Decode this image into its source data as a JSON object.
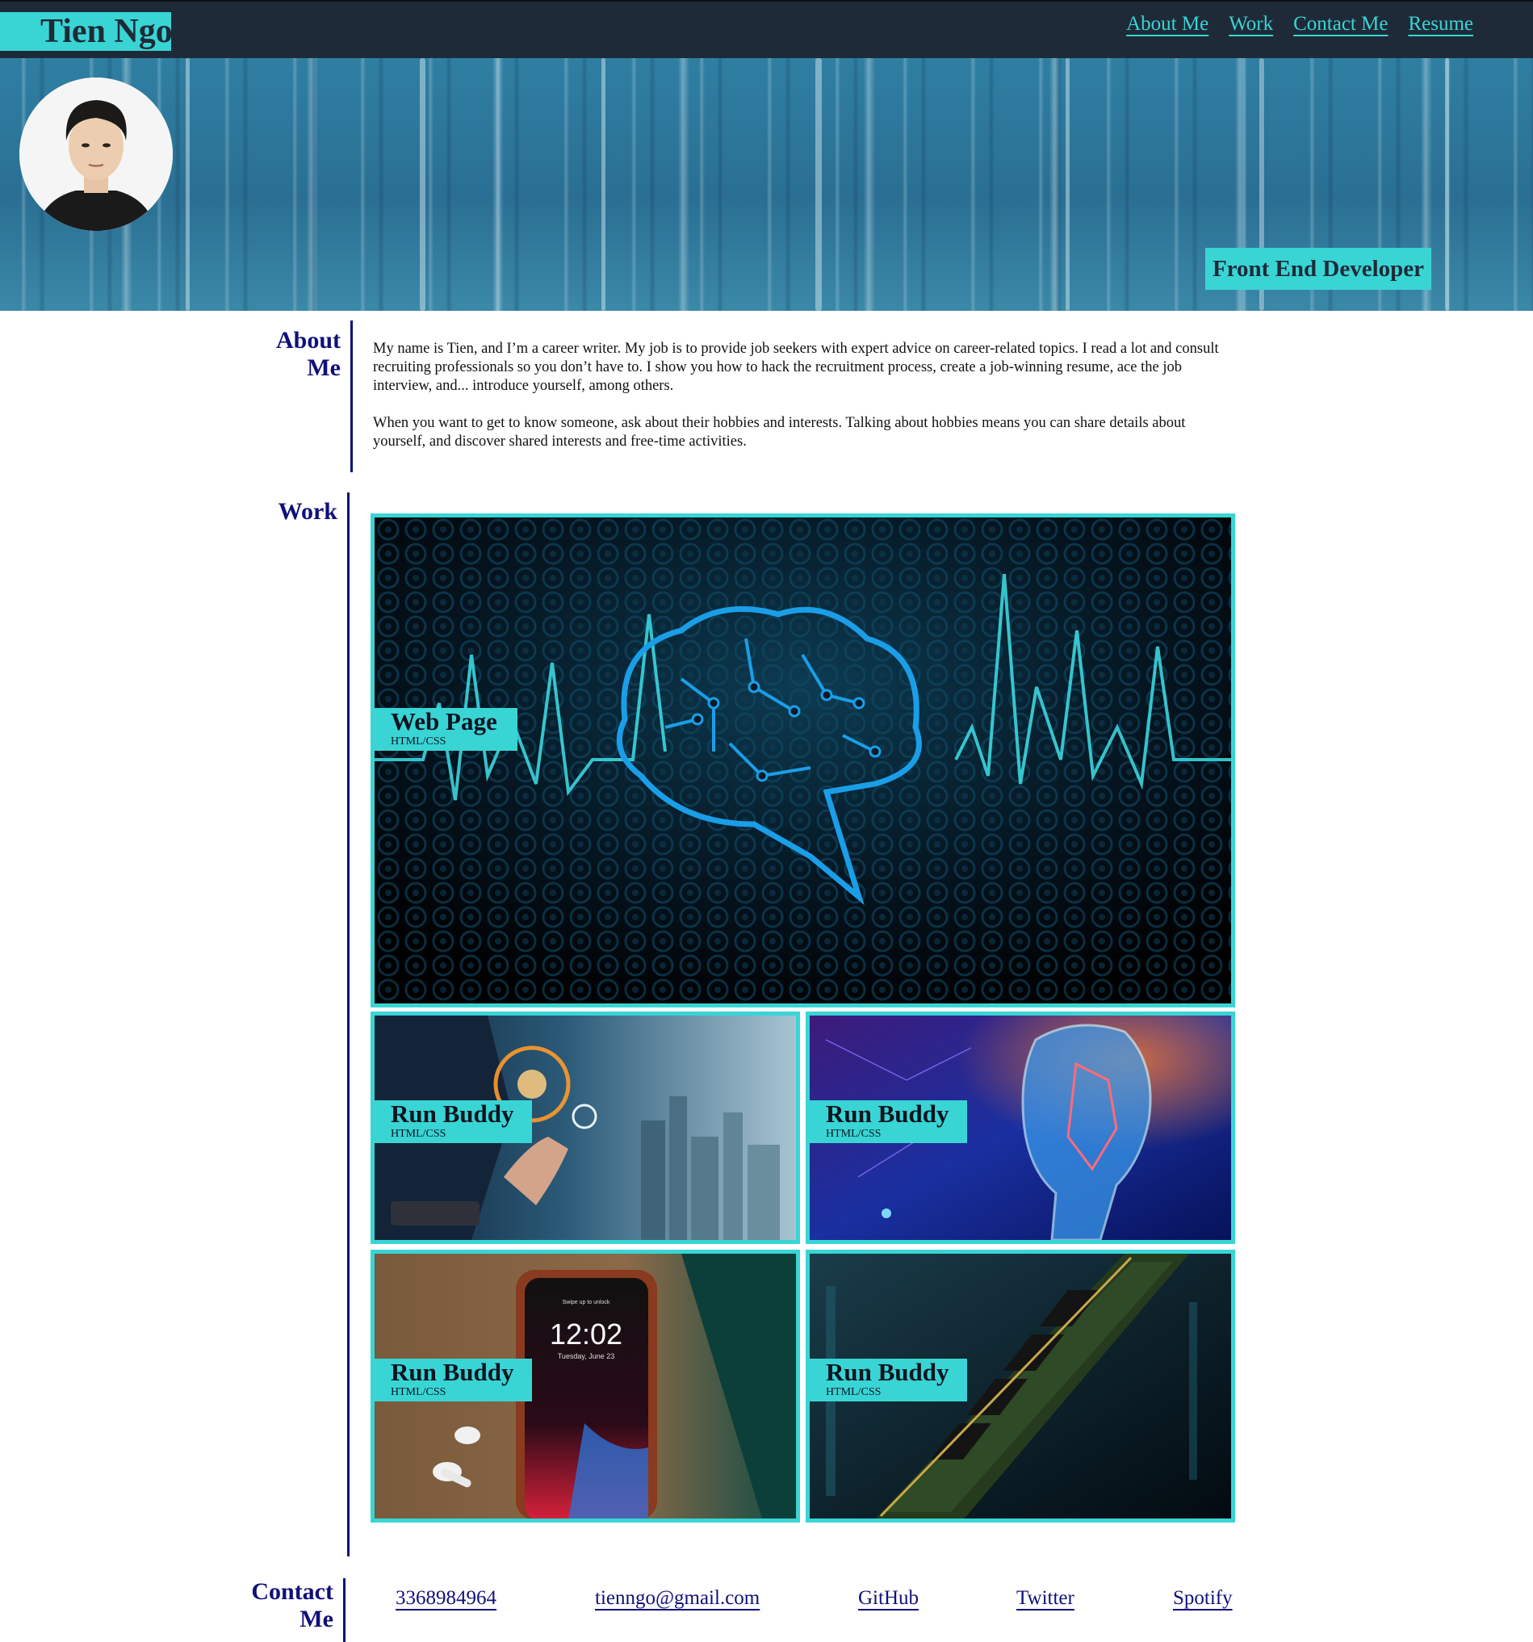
{
  "header": {
    "brand": "Tien Ngo",
    "nav": [
      "About Me",
      "Work",
      "Contact Me",
      "Resume"
    ]
  },
  "hero": {
    "role": "Front End Developer"
  },
  "about": {
    "title_line1": "About",
    "title_line2": "Me",
    "paragraphs": [
      "My name is Tien, and I’m a career writer. My job is to provide job seekers with expert advice on career-related topics. I read a lot and consult recruiting professionals so you don’t have to. I show you how to hack the recruitment process, create a job-winning resume, ace the job interview, and... introduce yourself, among others.",
      "When you want to get to know someone, ask about their hobbies and interests. Talking about hobbies means you can share details about yourself, and discover shared interests and free-time activities."
    ]
  },
  "work": {
    "title": "Work",
    "projects": [
      {
        "title": "Web Page",
        "tech": "HTML/CSS",
        "image": "neon-brain-circuit"
      },
      {
        "title": "Run Buddy",
        "tech": "HTML/CSS",
        "image": "hand-touching-gears-city"
      },
      {
        "title": "Run Buddy",
        "tech": "HTML/CSS",
        "image": "digital-face-profile"
      },
      {
        "title": "Run Buddy",
        "tech": "HTML/CSS",
        "image": "smartphone-on-wood"
      },
      {
        "title": "Run Buddy",
        "tech": "HTML/CSS",
        "image": "ram-memory-module"
      }
    ],
    "phone_screen": {
      "time": "12:02",
      "date": "Tuesday, June 23",
      "hint": "Swipe up to unlock"
    }
  },
  "contact": {
    "title_line1": "Contact",
    "title_line2": "Me",
    "links": [
      "3368984964",
      "tienngo@gmail.com",
      "GitHub",
      "Twitter",
      "Spotify"
    ]
  },
  "colors": {
    "accent": "#39d5d5",
    "nav_bg": "#1f2a38",
    "heading": "#10107a"
  }
}
